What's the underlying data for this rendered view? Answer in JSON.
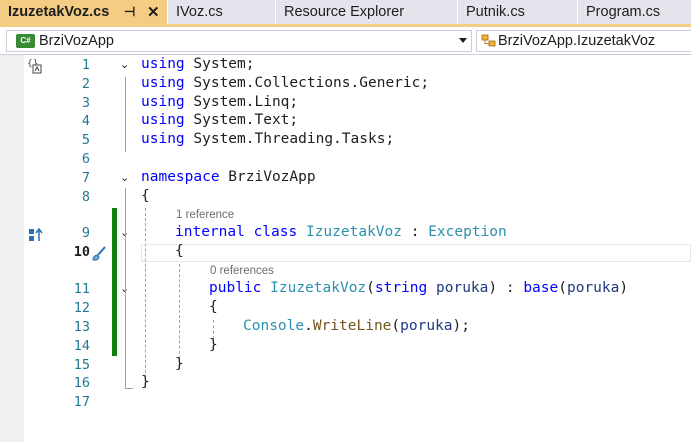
{
  "tabs": [
    {
      "label": "IzuzetakVoz.cs",
      "active": true,
      "pin": "⊣",
      "close": "✕"
    },
    {
      "label": "IVoz.cs",
      "active": false
    },
    {
      "label": "Resource Explorer",
      "active": false
    },
    {
      "label": "Putnik.cs",
      "active": false
    },
    {
      "label": "Program.cs",
      "active": false
    }
  ],
  "navbar": {
    "project": "BrziVozApp",
    "project_icon_text": "C#",
    "member": "BrziVozApp.IzuzetakVoz"
  },
  "code_lens": {
    "class_refs": "1 reference",
    "ctor_refs": "0 references"
  },
  "line_numbers": [
    "1",
    "2",
    "3",
    "4",
    "5",
    "6",
    "7",
    "8",
    "9",
    "10",
    "11",
    "12",
    "13",
    "14",
    "15",
    "16",
    "17"
  ],
  "code": {
    "l1": {
      "kw": "using",
      "rest": " System;"
    },
    "l2": {
      "kw": "using",
      "rest": " System.Collections.Generic;"
    },
    "l3": {
      "kw": "using",
      "rest": " System.Linq;"
    },
    "l4": {
      "kw": "using",
      "rest": " System.Text;"
    },
    "l5": {
      "kw": "using",
      "rest": " System.Threading.Tasks;"
    },
    "l7": {
      "kw": "namespace",
      "rest": " BrziVozApp"
    },
    "l8": "{",
    "l9": {
      "kw1": "internal",
      "kw2": "class",
      "name": "IzuzetakVoz",
      "sep": " : ",
      "base": "Exception"
    },
    "l10": "{",
    "l11": {
      "kw": "public",
      "name": "IzuzetakVoz",
      "open": "(",
      "ptype": "string",
      "pname": "poruka",
      "mid": ") : ",
      "base": "base",
      "bopen": "(",
      "barg": "poruka",
      "close": ")"
    },
    "l12": "{",
    "l13": {
      "cls": "Console",
      "dot": ".",
      "method": "WriteLine",
      "open": "(",
      "arg": "poruka",
      "close": ");"
    },
    "l14": "}",
    "l15": "}",
    "l16": "}"
  },
  "colors": {
    "keyword": "#0000ff",
    "type": "#2b91af",
    "method": "#74531f",
    "parameter": "#1f377f",
    "line_number": "#237893",
    "change_bar": "#108010",
    "active_tab": "#f5cc84"
  }
}
